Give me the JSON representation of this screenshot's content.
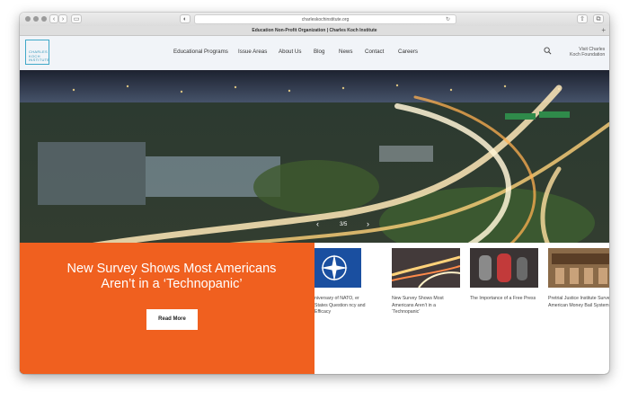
{
  "browser": {
    "url": "charleskochinstitute.org",
    "tab_title": "Education Non-Profit Organization | Charles Koch Institute"
  },
  "site": {
    "logo_lines": [
      "CHARLES",
      "KOCH",
      "INSTITUTE"
    ],
    "nav": [
      "Educational Programs",
      "Issue Areas",
      "About Us",
      "Blog",
      "News",
      "Contact",
      "Careers"
    ],
    "visit_line1": "Visit Charles",
    "visit_line2": "Koch Foundation"
  },
  "hero": {
    "headline": "New Survey Shows Most Americans Aren’t in a ‘Technopanic’",
    "cta": "Read More"
  },
  "carousel": {
    "counter": "3/5",
    "items": [
      {
        "caption": "niversary of NATO, er States Question ncy and Efficacy"
      },
      {
        "caption": "New Survey Shows Most Americans Aren’t in a ‘Technopanic’"
      },
      {
        "caption": "The Importance of a Free Press"
      },
      {
        "caption": "Pretrial Justice Institute Survey an American Money Bail System"
      }
    ]
  },
  "colors": {
    "accent_orange": "#f0601f",
    "logo_teal": "#3fa8c8"
  },
  "icons": [
    "privacy-icon",
    "reload-icon",
    "share-icon",
    "tabs-icon",
    "search-icon",
    "chevron-left-icon",
    "chevron-right-icon"
  ]
}
